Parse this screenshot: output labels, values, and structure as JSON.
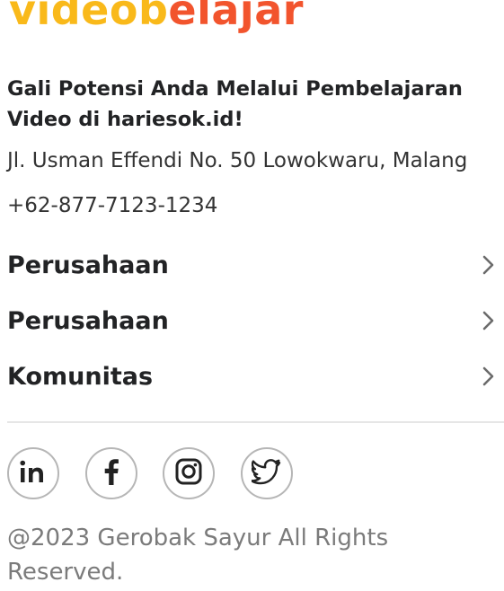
{
  "brand": {
    "logo_part1": "videob",
    "logo_part2": "elajar",
    "colors": {
      "primary": "#F9B91A",
      "secondary": "#F2542D"
    }
  },
  "footer": {
    "tagline": "Gali Potensi Anda Melalui Pembelajaran Video di hariesok.id!",
    "address": "Jl. Usman Effendi No. 50 Lowokwaru, Malang",
    "phone": "+62-877-7123-1234",
    "nav_items": [
      {
        "label": "Perusahaan",
        "icon": "chevron-right-icon"
      },
      {
        "label": "Perusahaan",
        "icon": "chevron-right-icon"
      },
      {
        "label": "Komunitas",
        "icon": "chevron-right-icon"
      }
    ],
    "social": [
      {
        "icon": "linkedin-icon"
      },
      {
        "icon": "facebook-icon"
      },
      {
        "icon": "instagram-icon"
      },
      {
        "icon": "twitter-icon"
      }
    ],
    "copyright": "@2023 Gerobak Sayur All Rights Reserved."
  }
}
